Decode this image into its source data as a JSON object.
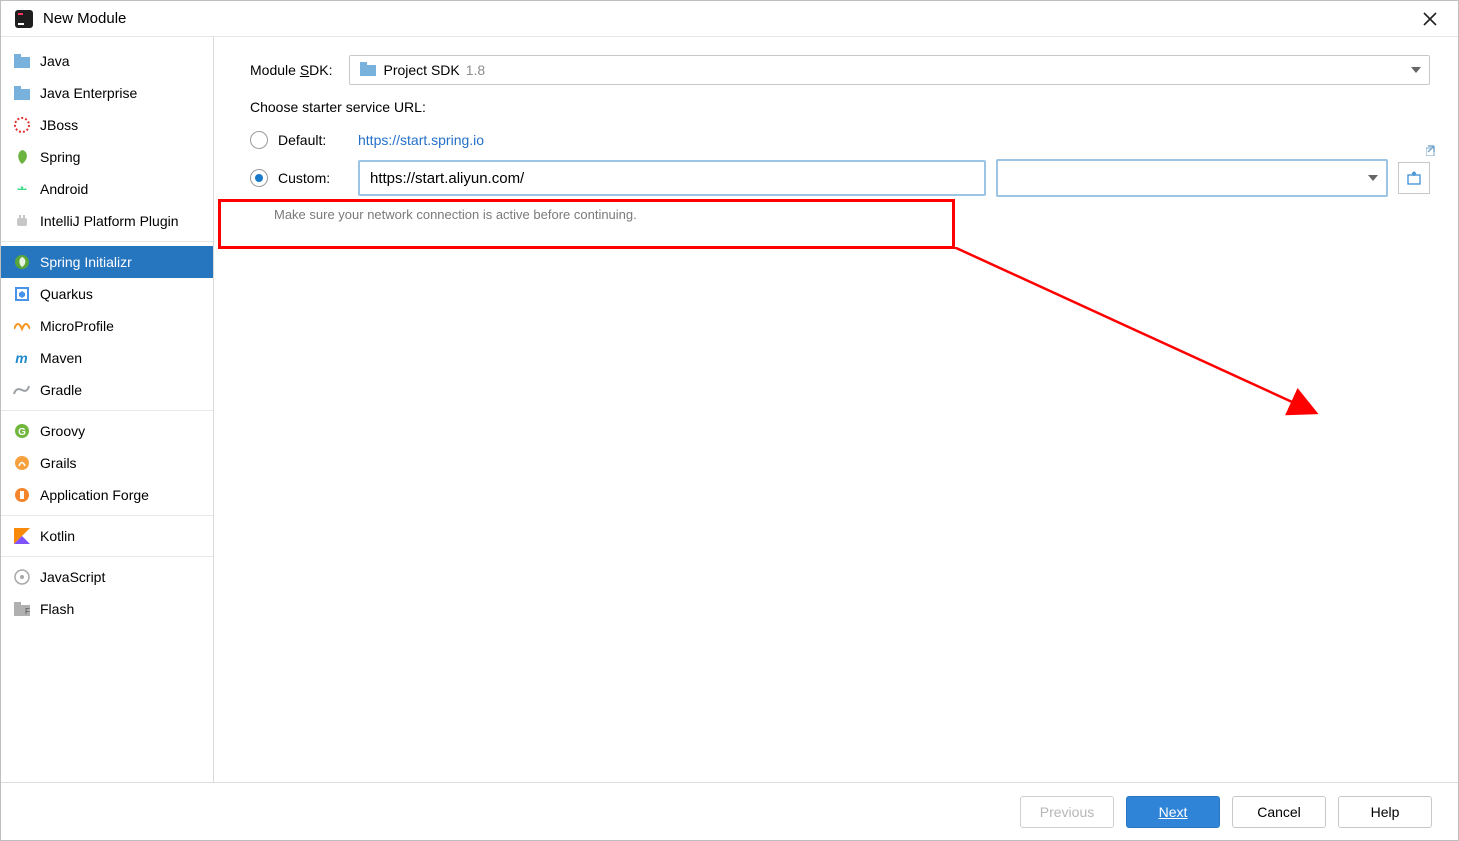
{
  "window": {
    "title": "New Module"
  },
  "sidebar": {
    "groups": [
      {
        "items": [
          {
            "label": "Java",
            "icon": "folder-blue"
          },
          {
            "label": "Java Enterprise",
            "icon": "folder-blue"
          },
          {
            "label": "JBoss",
            "icon": "red-dots"
          },
          {
            "label": "Spring",
            "icon": "spring-leaf"
          },
          {
            "label": "Android",
            "icon": "android"
          },
          {
            "label": "IntelliJ Platform Plugin",
            "icon": "plugin"
          }
        ]
      },
      {
        "items": [
          {
            "label": "Spring Initializr",
            "icon": "spring-leaf-sel",
            "selected": true
          },
          {
            "label": "Quarkus",
            "icon": "quarkus"
          },
          {
            "label": "MicroProfile",
            "icon": "microprofile"
          },
          {
            "label": "Maven",
            "icon": "maven"
          },
          {
            "label": "Gradle",
            "icon": "gradle"
          }
        ]
      },
      {
        "items": [
          {
            "label": "Groovy",
            "icon": "groovy"
          },
          {
            "label": "Grails",
            "icon": "grails"
          },
          {
            "label": "Application Forge",
            "icon": "forge"
          }
        ]
      },
      {
        "items": [
          {
            "label": "Kotlin",
            "icon": "kotlin"
          }
        ]
      },
      {
        "items": [
          {
            "label": "JavaScript",
            "icon": "js"
          },
          {
            "label": "Flash",
            "icon": "folder-grey"
          }
        ]
      }
    ]
  },
  "main": {
    "sdk_label_pre": "Module ",
    "sdk_label_u": "S",
    "sdk_label_post": "DK:",
    "sdk_value": "Project SDK",
    "sdk_version": "1.8",
    "starter_label": "Choose starter service URL:",
    "default_label": "Default:",
    "default_url": "https://start.spring.io",
    "custom_label": "Custom:",
    "custom_value": "https://start.aliyun.com/",
    "note": "Make sure your network connection is active before continuing."
  },
  "footer": {
    "previous": "Previous",
    "next_u": "N",
    "next_post": "ext",
    "cancel": "Cancel",
    "help": "Help"
  }
}
